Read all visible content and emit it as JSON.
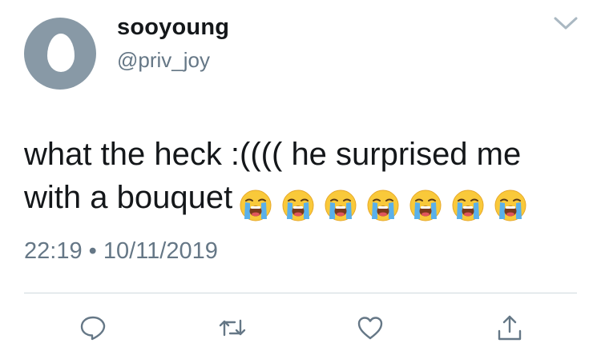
{
  "user": {
    "display_name": "sooyoung",
    "handle": "@priv_joy",
    "avatar": "default-egg-avatar"
  },
  "tweet": {
    "text_line1": "what the heck :(((( he surprised me",
    "text_line2": "with a bouquet",
    "emoji": [
      "loudly-crying-face",
      "loudly-crying-face",
      "loudly-crying-face",
      "loudly-crying-face",
      "loudly-crying-face",
      "loudly-crying-face",
      "loudly-crying-face"
    ],
    "time": "22:19",
    "separator": "•",
    "date": "10/11/2019"
  },
  "actions": [
    {
      "name": "reply",
      "icon": "speech-bubble-icon"
    },
    {
      "name": "retweet",
      "icon": "retweet-icon"
    },
    {
      "name": "like",
      "icon": "heart-icon"
    },
    {
      "name": "share",
      "icon": "share-icon"
    }
  ],
  "colors": {
    "text": "#14171a",
    "secondary": "#657786",
    "avatar_bg": "#8899a6",
    "divider": "#cfd9de",
    "icon": "#657786"
  }
}
